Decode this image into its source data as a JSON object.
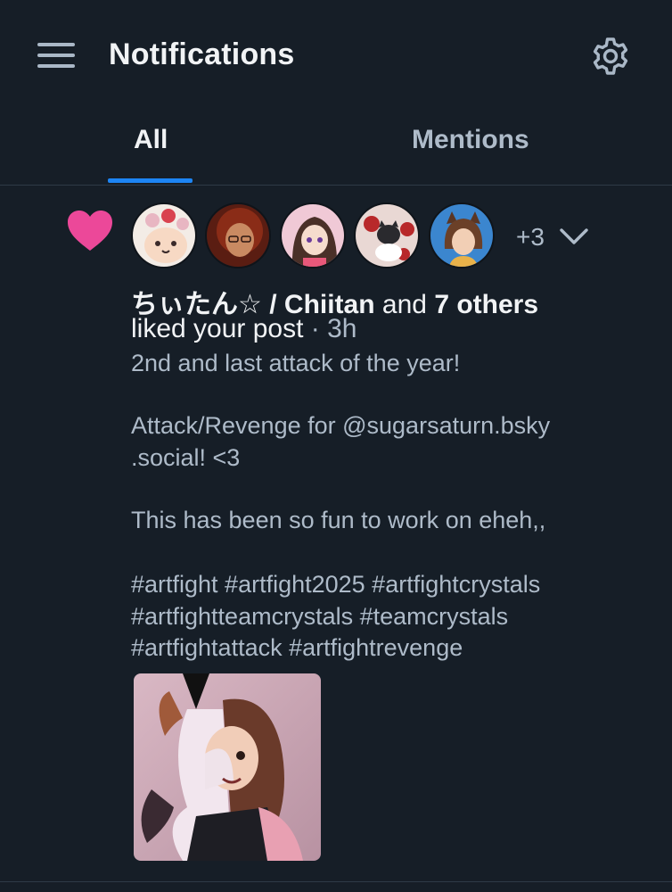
{
  "header": {
    "title": "Notifications",
    "menu_icon": "hamburger-icon",
    "settings_icon": "gear-icon"
  },
  "tabs": [
    {
      "label": "All",
      "active": true
    },
    {
      "label": "Mentions",
      "active": false
    }
  ],
  "notification": {
    "type_icon": "heart-icon",
    "type_color": "#ec4899",
    "extra_avatars": "+3",
    "actor_name": "ちぃたん☆ / Chiitan",
    "connector": "and",
    "others": "7 others",
    "action": "liked your post",
    "time": "· 3h",
    "post_lines": [
      "2nd and last attack of the year!",
      "",
      "Attack/Revenge for @sugarsaturn.bsky",
      ".social! <3",
      "",
      "This has been so fun to work on eheh,,",
      "",
      "#artfight #artfight2025 #artfightcrystals",
      "#artfightteamcrystals #teamcrystals",
      "#artfightattack #artfightrevenge"
    ]
  },
  "colors": {
    "background": "#161e27",
    "accent": "#1d85f4",
    "muted_text": "#aebbc9"
  }
}
